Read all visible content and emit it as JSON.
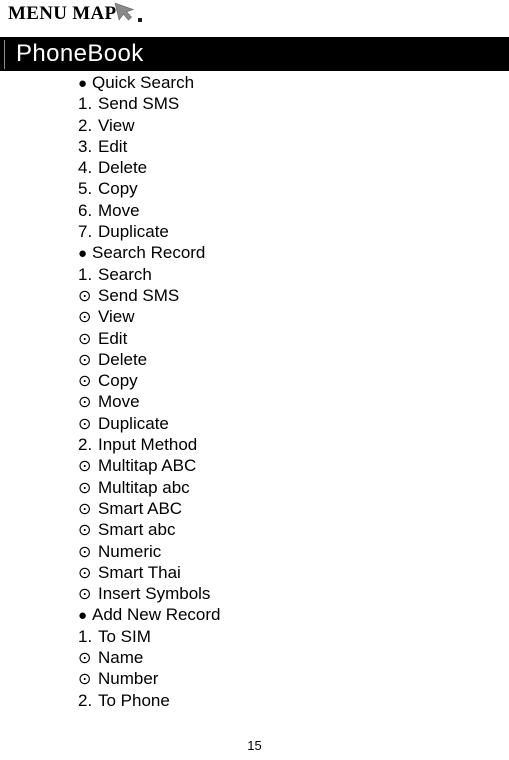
{
  "header": {
    "title": "MENU MAP",
    "cursor_icon": "arrow-cursor-icon",
    "trailing_mark": "."
  },
  "section": {
    "label": "PhoneBook",
    "background_color": "#000000",
    "text_color": "#ffffff"
  },
  "bullets": {
    "level1": "●",
    "level3": "⊙"
  },
  "menu_items": [
    {
      "level": 1,
      "bullet": "●",
      "label": "Quick Search"
    },
    {
      "level": 2,
      "bullet": "1.",
      "label": "Send SMS"
    },
    {
      "level": 2,
      "bullet": "2.",
      "label": "View"
    },
    {
      "level": 2,
      "bullet": "3.",
      "label": "Edit"
    },
    {
      "level": 2,
      "bullet": "4.",
      "label": "Delete"
    },
    {
      "level": 2,
      "bullet": "5.",
      "label": "Copy"
    },
    {
      "level": 2,
      "bullet": "6.",
      "label": "Move"
    },
    {
      "level": 2,
      "bullet": "7.",
      "label": "Duplicate"
    },
    {
      "level": 1,
      "bullet": "●",
      "label": "Search Record"
    },
    {
      "level": 2,
      "bullet": "1.",
      "label": "Search"
    },
    {
      "level": 3,
      "bullet": "⊙",
      "label": "Send SMS"
    },
    {
      "level": 3,
      "bullet": "⊙",
      "label": "View"
    },
    {
      "level": 3,
      "bullet": "⊙",
      "label": "Edit"
    },
    {
      "level": 3,
      "bullet": "⊙",
      "label": "Delete"
    },
    {
      "level": 3,
      "bullet": "⊙",
      "label": "Copy"
    },
    {
      "level": 3,
      "bullet": "⊙",
      "label": "Move"
    },
    {
      "level": 3,
      "bullet": "⊙",
      "label": "Duplicate"
    },
    {
      "level": 2,
      "bullet": "2.",
      "label": "Input Method"
    },
    {
      "level": 3,
      "bullet": "⊙",
      "label": "Multitap ABC"
    },
    {
      "level": 3,
      "bullet": "⊙",
      "label": "Multitap abc"
    },
    {
      "level": 3,
      "bullet": "⊙",
      "label": "Smart ABC"
    },
    {
      "level": 3,
      "bullet": "⊙",
      "label": "Smart abc"
    },
    {
      "level": 3,
      "bullet": "⊙",
      "label": "Numeric"
    },
    {
      "level": 3,
      "bullet": "⊙",
      "label": "Smart Thai"
    },
    {
      "level": 3,
      "bullet": "⊙",
      "label": "Insert Symbols"
    },
    {
      "level": 1,
      "bullet": "●",
      "label": "Add New Record"
    },
    {
      "level": 2,
      "bullet": "1.",
      "label": "To SIM"
    },
    {
      "level": 3,
      "bullet": "⊙",
      "label": "Name"
    },
    {
      "level": 3,
      "bullet": "⊙",
      "label": "Number"
    },
    {
      "level": 2,
      "bullet": "2.",
      "label": "To Phone"
    }
  ],
  "footer": {
    "page_number": "15"
  }
}
